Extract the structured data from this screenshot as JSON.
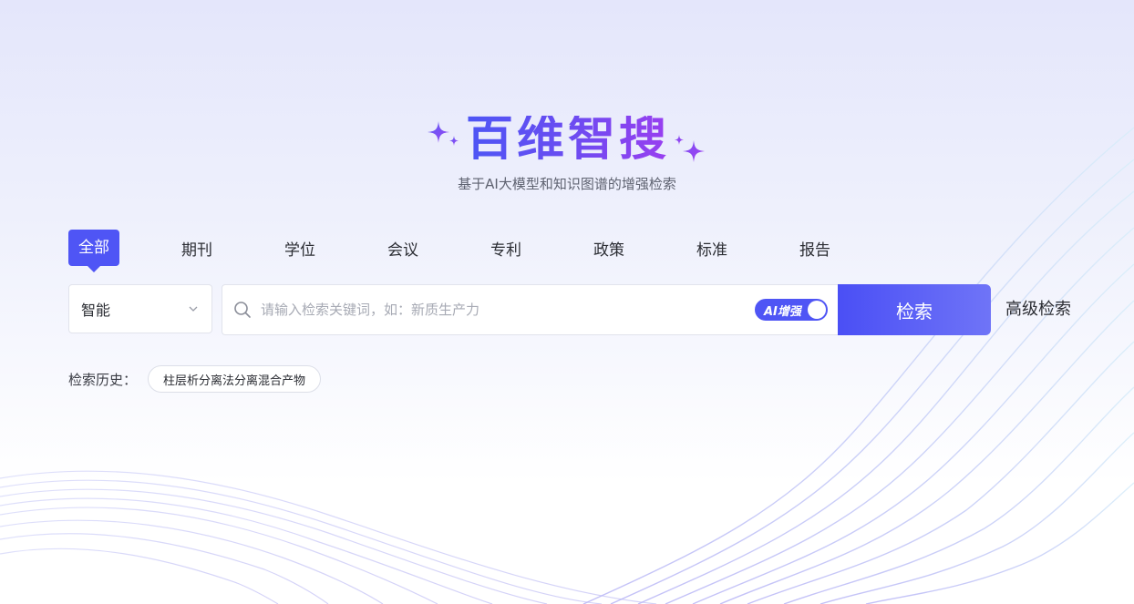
{
  "brand": {
    "title": "百维智搜",
    "subtitle": "基于AI大模型和知识图谱的增强检索",
    "accent_color": "#4f55f5"
  },
  "tabs": [
    {
      "label": "全部",
      "active": true
    },
    {
      "label": "期刊",
      "active": false
    },
    {
      "label": "学位",
      "active": false
    },
    {
      "label": "会议",
      "active": false
    },
    {
      "label": "专利",
      "active": false
    },
    {
      "label": "政策",
      "active": false
    },
    {
      "label": "标准",
      "active": false
    },
    {
      "label": "报告",
      "active": false
    }
  ],
  "search": {
    "mode_selected": "智能",
    "placeholder": "请输入检索关键词，如：新质生产力",
    "value": "",
    "ai_toggle_label": "AI增强",
    "ai_toggle_on": true,
    "button_label": "检索",
    "advanced_label": "高级检索"
  },
  "history": {
    "label": "检索历史：",
    "items": [
      "柱层析分离法分离混合产物"
    ]
  },
  "icons": {
    "sparkle": "sparkle-icon",
    "dropdown": "chevron-down-icon",
    "search": "search-icon"
  }
}
